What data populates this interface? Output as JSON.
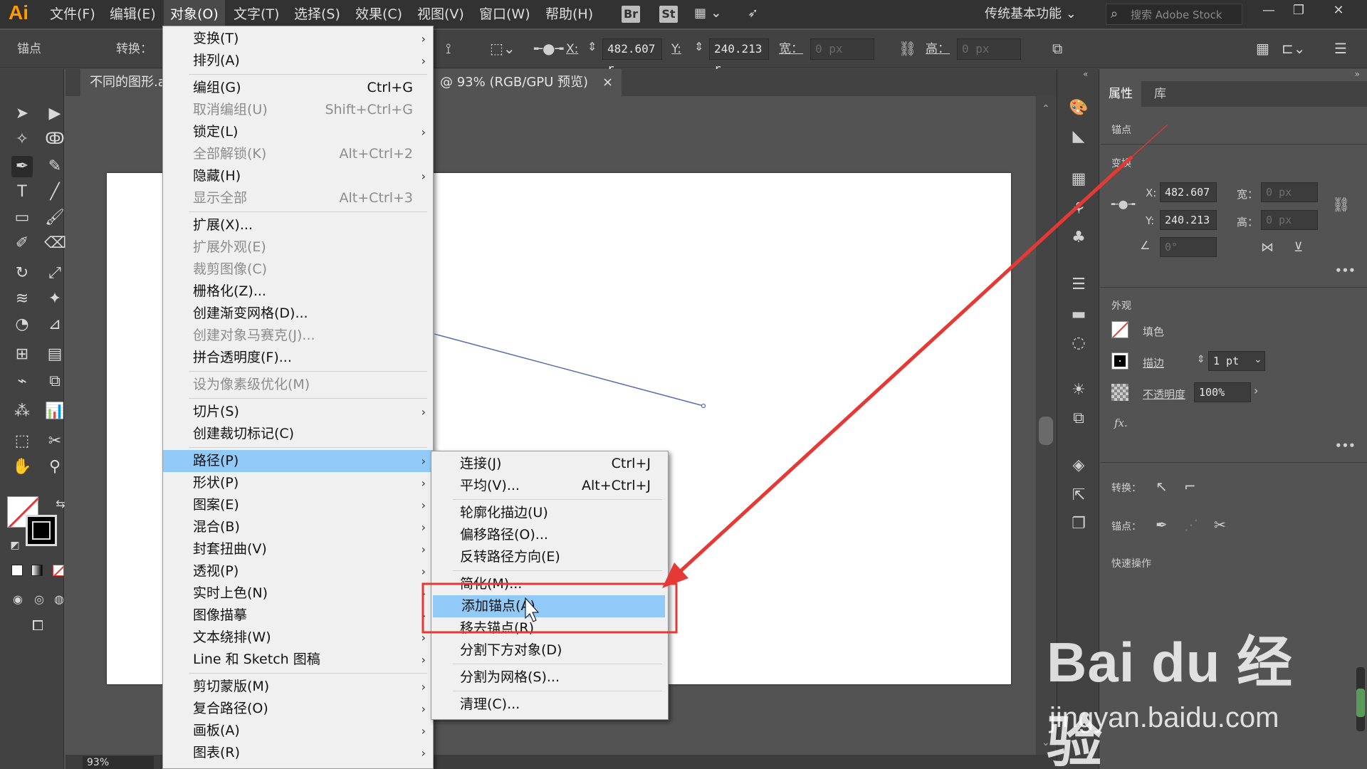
{
  "app": {
    "logo": "Ai",
    "workspace": "传统基本功能",
    "search_placeholder": "搜索 Adobe Stock"
  },
  "menubar": {
    "items": [
      "文件(F)",
      "编辑(E)",
      "对象(O)",
      "文字(T)",
      "选择(S)",
      "效果(C)",
      "视图(V)",
      "窗口(W)",
      "帮助(H)"
    ],
    "active": "对象(O)",
    "icons": {
      "bridge": "Br",
      "stock": "St"
    }
  },
  "controlbar": {
    "mode_label": "锚点",
    "convert_label": "转换：",
    "x_label": "X:",
    "x_value": "482.607 r",
    "y_label": "Y:",
    "y_value": "240.213 r",
    "w_label": "宽：",
    "w_value": "0 px",
    "h_label": "高：",
    "h_value": "0 px"
  },
  "document": {
    "tab_left": "不同的图形.a",
    "tab_title": "@ 93% (RGB/GPU 预览)",
    "tab_close": "×",
    "zoom": "93%"
  },
  "object_menu": {
    "items": [
      {
        "label": "变换(T)",
        "shortcut": "",
        "submenu": true,
        "disabled": false
      },
      {
        "label": "排列(A)",
        "shortcut": "",
        "submenu": true,
        "disabled": false
      },
      {
        "label": "编组(G)",
        "shortcut": "Ctrl+G",
        "submenu": false,
        "disabled": false
      },
      {
        "label": "取消编组(U)",
        "shortcut": "Shift+Ctrl+G",
        "submenu": false,
        "disabled": true
      },
      {
        "label": "锁定(L)",
        "shortcut": "",
        "submenu": true,
        "disabled": false
      },
      {
        "label": "全部解锁(K)",
        "shortcut": "Alt+Ctrl+2",
        "submenu": false,
        "disabled": true
      },
      {
        "label": "隐藏(H)",
        "shortcut": "",
        "submenu": true,
        "disabled": false
      },
      {
        "label": "显示全部",
        "shortcut": "Alt+Ctrl+3",
        "submenu": false,
        "disabled": true
      },
      {
        "label": "扩展(X)...",
        "shortcut": "",
        "submenu": false,
        "disabled": false
      },
      {
        "label": "扩展外观(E)",
        "shortcut": "",
        "submenu": false,
        "disabled": true
      },
      {
        "label": "裁剪图像(C)",
        "shortcut": "",
        "submenu": false,
        "disabled": true
      },
      {
        "label": "栅格化(Z)...",
        "shortcut": "",
        "submenu": false,
        "disabled": false
      },
      {
        "label": "创建渐变网格(D)...",
        "shortcut": "",
        "submenu": false,
        "disabled": false
      },
      {
        "label": "创建对象马赛克(J)...",
        "shortcut": "",
        "submenu": false,
        "disabled": true
      },
      {
        "label": "拼合透明度(F)...",
        "shortcut": "",
        "submenu": false,
        "disabled": false
      },
      {
        "label": "设为像素级优化(M)",
        "shortcut": "",
        "submenu": false,
        "disabled": true
      },
      {
        "label": "切片(S)",
        "shortcut": "",
        "submenu": true,
        "disabled": false
      },
      {
        "label": "创建裁切标记(C)",
        "shortcut": "",
        "submenu": false,
        "disabled": false
      },
      {
        "label": "路径(P)",
        "shortcut": "",
        "submenu": true,
        "disabled": false,
        "highlight": true
      },
      {
        "label": "形状(P)",
        "shortcut": "",
        "submenu": true,
        "disabled": false
      },
      {
        "label": "图案(E)",
        "shortcut": "",
        "submenu": true,
        "disabled": false
      },
      {
        "label": "混合(B)",
        "shortcut": "",
        "submenu": true,
        "disabled": false
      },
      {
        "label": "封套扭曲(V)",
        "shortcut": "",
        "submenu": true,
        "disabled": false
      },
      {
        "label": "透视(P)",
        "shortcut": "",
        "submenu": true,
        "disabled": false
      },
      {
        "label": "实时上色(N)",
        "shortcut": "",
        "submenu": true,
        "disabled": false
      },
      {
        "label": "图像描摹",
        "shortcut": "",
        "submenu": true,
        "disabled": false
      },
      {
        "label": "文本绕排(W)",
        "shortcut": "",
        "submenu": true,
        "disabled": false
      },
      {
        "label": "Line 和 Sketch 图稿",
        "shortcut": "",
        "submenu": true,
        "disabled": false
      },
      {
        "label": "剪切蒙版(M)",
        "shortcut": "",
        "submenu": true,
        "disabled": false
      },
      {
        "label": "复合路径(O)",
        "shortcut": "",
        "submenu": true,
        "disabled": false
      },
      {
        "label": "画板(A)",
        "shortcut": "",
        "submenu": true,
        "disabled": false
      },
      {
        "label": "图表(R)",
        "shortcut": "",
        "submenu": true,
        "disabled": false
      }
    ]
  },
  "path_submenu": {
    "items": [
      {
        "label": "连接(J)",
        "shortcut": "Ctrl+J"
      },
      {
        "label": "平均(V)...",
        "shortcut": "Alt+Ctrl+J"
      },
      {
        "label": "轮廓化描边(U)",
        "shortcut": ""
      },
      {
        "label": "偏移路径(O)...",
        "shortcut": ""
      },
      {
        "label": "反转路径方向(E)",
        "shortcut": ""
      },
      {
        "label": "简化(M)...",
        "shortcut": ""
      },
      {
        "label": "添加锚点(A)",
        "shortcut": "",
        "highlight": true
      },
      {
        "label": "移去锚点(R)",
        "shortcut": ""
      },
      {
        "label": "分割下方对象(D)",
        "shortcut": ""
      },
      {
        "label": "分割为网格(S)...",
        "shortcut": ""
      },
      {
        "label": "清理(C)...",
        "shortcut": ""
      }
    ]
  },
  "properties_panel": {
    "tabs": [
      "属性",
      "库"
    ],
    "active_tab": "属性",
    "selection_type": "锚点",
    "transform_title": "变换",
    "x_label": "X:",
    "x_value": "482.607",
    "y_label": "Y:",
    "y_value": "240.213",
    "w_label": "宽：",
    "w_value": "0 px",
    "h_label": "高：",
    "h_value": "0 px",
    "angle_value": "0°",
    "appearance_title": "外观",
    "fill_label": "填色",
    "stroke_label": "描边",
    "stroke_value": "1 pt",
    "opacity_label": "不透明度",
    "opacity_value": "100%",
    "fx_label": "fx.",
    "convert_label": "转换：",
    "anchor_label": "锚点：",
    "quick_actions_title": "快速操作",
    "more": "•••"
  },
  "watermark": {
    "brand": "Bai du 经验",
    "url": "jingyan.baidu.com"
  },
  "colors": {
    "highlight": "#91c9f7",
    "annotation": "#e53935",
    "logo": "#ff9a00"
  }
}
